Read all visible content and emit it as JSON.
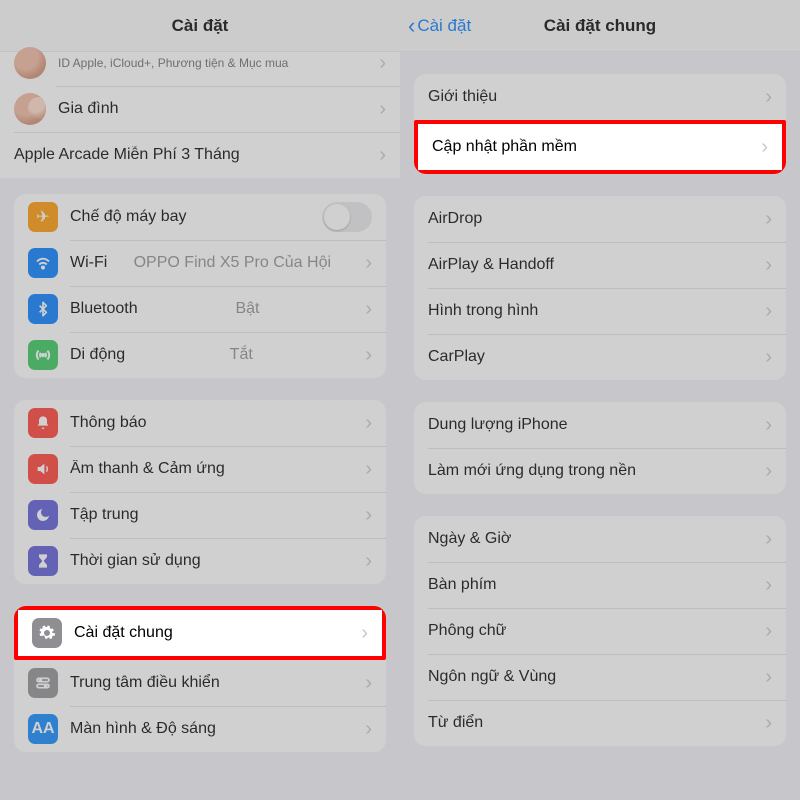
{
  "left": {
    "title": "Cài đặt",
    "apple_id_sub": "ID Apple, iCloud+, Phương tiện & Mục mua",
    "family": "Gia đình",
    "arcade": "Apple Arcade Miễn Phí 3 Tháng",
    "airplane": "Chế độ máy bay",
    "wifi": "Wi-Fi",
    "wifi_detail": "OPPO Find X5 Pro Của Hội",
    "bluetooth": "Bluetooth",
    "bluetooth_detail": "Bật",
    "cellular": "Di động",
    "cellular_detail": "Tắt",
    "notifications": "Thông báo",
    "sounds": "Âm thanh & Cảm ứng",
    "focus": "Tập trung",
    "screentime": "Thời gian sử dụng",
    "general": "Cài đặt chung",
    "control_center": "Trung tâm điều khiển",
    "display": "Màn hình & Độ sáng"
  },
  "right": {
    "back": "Cài đặt",
    "title": "Cài đặt chung",
    "about": "Giới thiệu",
    "software_update": "Cập nhật phần mềm",
    "airdrop": "AirDrop",
    "airplay": "AirPlay & Handoff",
    "pip": "Hình trong hình",
    "carplay": "CarPlay",
    "storage": "Dung lượng iPhone",
    "background_refresh": "Làm mới ứng dụng trong nền",
    "date_time": "Ngày & Giờ",
    "keyboard": "Bàn phím",
    "fonts": "Phông chữ",
    "language": "Ngôn ngữ & Vùng",
    "dictionary": "Từ điển"
  }
}
